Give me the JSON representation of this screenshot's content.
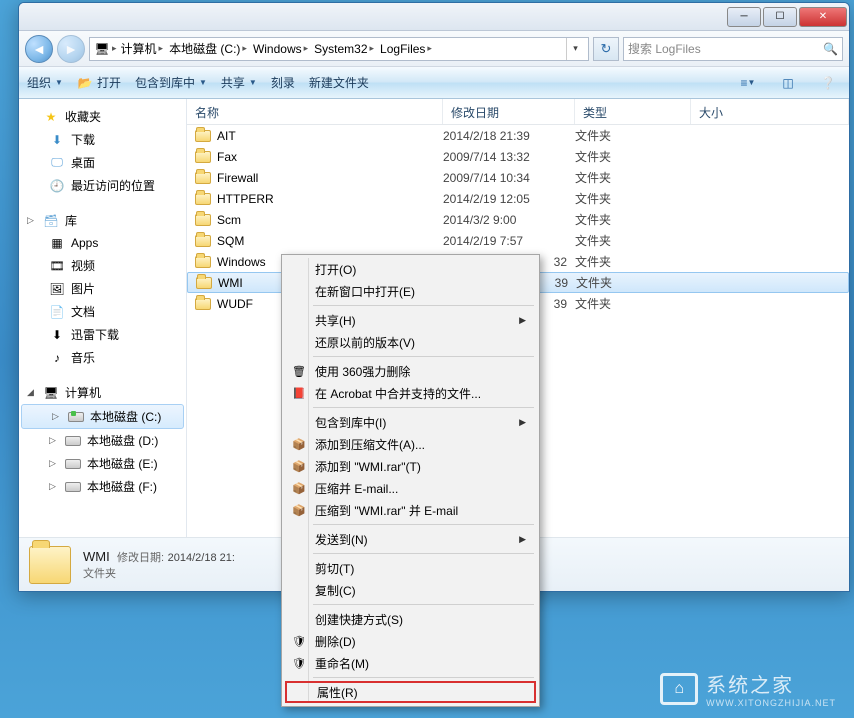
{
  "window_controls": {
    "min": "─",
    "max": "☐",
    "close": "✕"
  },
  "breadcrumb": {
    "root_icon": "computer-icon",
    "items": [
      "计算机",
      "本地磁盘 (C:)",
      "Windows",
      "System32",
      "LogFiles"
    ]
  },
  "search": {
    "placeholder": "搜索 LogFiles"
  },
  "toolbar": {
    "organize": "组织",
    "open": "打开",
    "include": "包含到库中",
    "share": "共享",
    "burn": "刻录",
    "newfolder": "新建文件夹"
  },
  "sidebar": {
    "favorites": {
      "label": "收藏夹",
      "items": [
        {
          "label": "下载",
          "icon": "download-icon"
        },
        {
          "label": "桌面",
          "icon": "desktop-icon"
        },
        {
          "label": "最近访问的位置",
          "icon": "recent-icon"
        }
      ]
    },
    "libraries": {
      "label": "库",
      "items": [
        {
          "label": "Apps",
          "icon": "apps-icon"
        },
        {
          "label": "视频",
          "icon": "video-icon"
        },
        {
          "label": "图片",
          "icon": "pictures-icon"
        },
        {
          "label": "文档",
          "icon": "documents-icon"
        },
        {
          "label": "迅雷下载",
          "icon": "xunlei-icon"
        },
        {
          "label": "音乐",
          "icon": "music-icon"
        }
      ]
    },
    "computer": {
      "label": "计算机",
      "items": [
        {
          "label": "本地磁盘 (C:)",
          "icon": "drive-sys-icon",
          "selected": true
        },
        {
          "label": "本地磁盘 (D:)",
          "icon": "drive-icon"
        },
        {
          "label": "本地磁盘 (E:)",
          "icon": "drive-icon"
        },
        {
          "label": "本地磁盘 (F:)",
          "icon": "drive-icon"
        }
      ]
    }
  },
  "columns": {
    "name": "名称",
    "date": "修改日期",
    "type": "类型",
    "size": "大小"
  },
  "files": [
    {
      "name": "AIT",
      "date": "2014/2/18 21:39",
      "type": "文件夹"
    },
    {
      "name": "Fax",
      "date": "2009/7/14 13:32",
      "type": "文件夹"
    },
    {
      "name": "Firewall",
      "date": "2009/7/14 10:34",
      "type": "文件夹"
    },
    {
      "name": "HTTPERR",
      "date": "2014/2/19 12:05",
      "type": "文件夹"
    },
    {
      "name": "Scm",
      "date": "2014/3/2 9:00",
      "type": "文件夹"
    },
    {
      "name": "SQM",
      "date": "2014/2/19 7:57",
      "type": "文件夹"
    },
    {
      "name": "Windows",
      "date_partial": "32",
      "type": "文件夹"
    },
    {
      "name": "WMI",
      "date_partial": "39",
      "type": "文件夹",
      "selected": true
    },
    {
      "name": "WUDF",
      "date_partial": "39",
      "type": "文件夹"
    }
  ],
  "details": {
    "name": "WMI",
    "date_label": "修改日期:",
    "date_value": "2014/2/18 21:",
    "type": "文件夹"
  },
  "context_menu": [
    {
      "label": "打开(O)",
      "type": "item"
    },
    {
      "label": "在新窗口中打开(E)",
      "type": "item"
    },
    {
      "type": "sep"
    },
    {
      "label": "共享(H)",
      "type": "sub"
    },
    {
      "label": "还原以前的版本(V)",
      "type": "item"
    },
    {
      "type": "sep"
    },
    {
      "label": "使用 360强力删除",
      "type": "item",
      "icon": "trash-icon"
    },
    {
      "label": "在 Acrobat 中合并支持的文件...",
      "type": "item",
      "icon": "acrobat-icon"
    },
    {
      "type": "sep"
    },
    {
      "label": "包含到库中(I)",
      "type": "sub"
    },
    {
      "label": "添加到压缩文件(A)...",
      "type": "item",
      "icon": "rar-icon"
    },
    {
      "label": "添加到 \"WMI.rar\"(T)",
      "type": "item",
      "icon": "rar-icon"
    },
    {
      "label": "压缩并 E-mail...",
      "type": "item",
      "icon": "rar-icon"
    },
    {
      "label": "压缩到 \"WMI.rar\" 并 E-mail",
      "type": "item",
      "icon": "rar-icon"
    },
    {
      "type": "sep"
    },
    {
      "label": "发送到(N)",
      "type": "sub"
    },
    {
      "type": "sep"
    },
    {
      "label": "剪切(T)",
      "type": "item"
    },
    {
      "label": "复制(C)",
      "type": "item"
    },
    {
      "type": "sep"
    },
    {
      "label": "创建快捷方式(S)",
      "type": "item"
    },
    {
      "label": "删除(D)",
      "type": "item",
      "icon": "shield-icon"
    },
    {
      "label": "重命名(M)",
      "type": "item",
      "icon": "shield-icon"
    },
    {
      "type": "sep"
    },
    {
      "label": "属性(R)",
      "type": "item",
      "highlight": true
    }
  ],
  "watermark": {
    "brand": "系统之家",
    "url": "WWW.XITONGZHIJIA.NET"
  }
}
